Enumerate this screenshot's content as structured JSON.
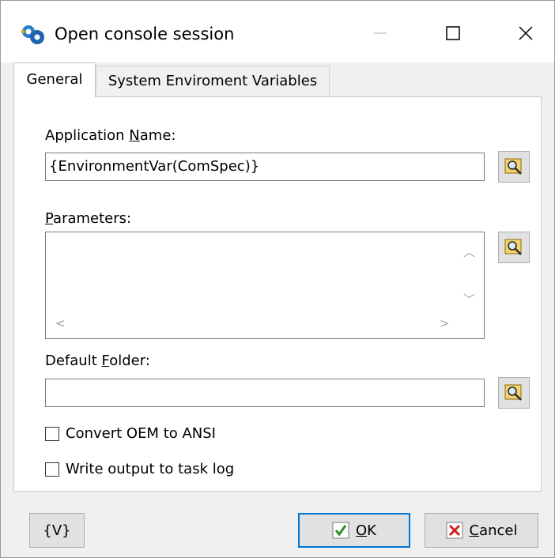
{
  "window": {
    "title": "Open console session",
    "icon": "app-gears-icon"
  },
  "tabs": [
    {
      "label": "General",
      "active": true
    },
    {
      "label": "System Enviroment Variables",
      "active": false
    }
  ],
  "general": {
    "application_name": {
      "label_pre": "Application ",
      "label_accel": "N",
      "label_post": "ame:",
      "value": "{EnvironmentVar(ComSpec)}"
    },
    "parameters": {
      "label_accel": "P",
      "label_post": "arameters:",
      "value": ""
    },
    "default_folder": {
      "label_pre": "Default ",
      "label_accel": "F",
      "label_post": "older:",
      "value": ""
    },
    "checkboxes": [
      {
        "label": "Convert OEM to ANSI",
        "checked": false
      },
      {
        "label": "Write output to task log",
        "checked": false
      }
    ]
  },
  "footer": {
    "variables_label": "{V}",
    "ok_accel": "O",
    "ok_post": "K",
    "cancel_accel": "C",
    "cancel_post": "ancel"
  },
  "colors": {
    "accent": "#0078d7",
    "ok_check": "#2e8b22",
    "cancel_x": "#d02020"
  }
}
